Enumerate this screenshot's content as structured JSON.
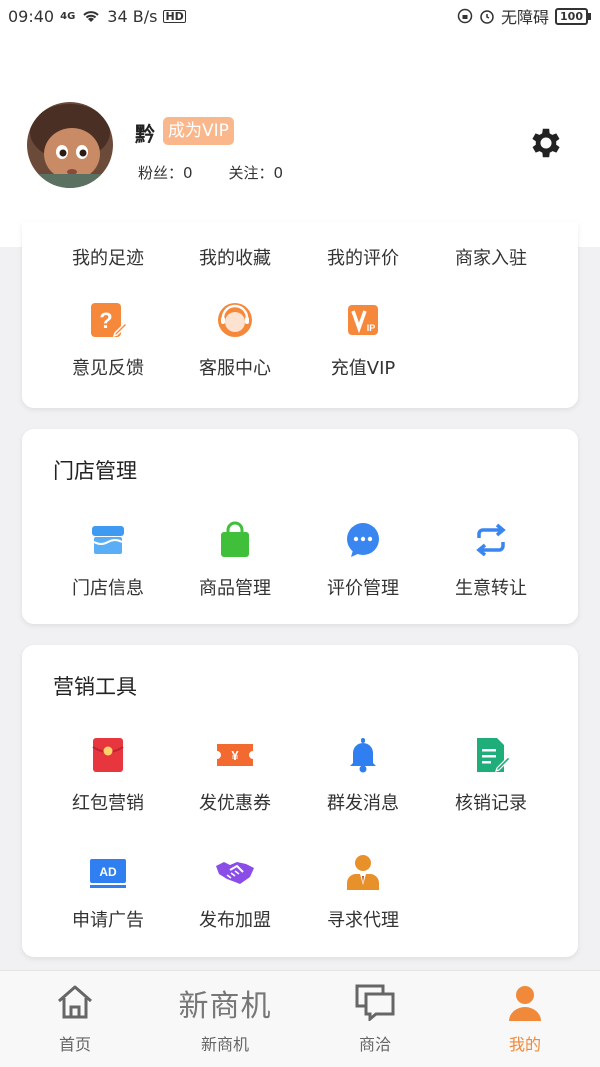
{
  "status_bar": {
    "time": "09:40",
    "network": "4G",
    "speed": "34 B/s",
    "hd": "HD",
    "accessibility": "无障碍",
    "battery": "100"
  },
  "profile": {
    "name": "黔",
    "vip_label": "成为VIP",
    "fans": "粉丝：0",
    "follow": "关注：0",
    "settings_icon": "gear-icon"
  },
  "card1": {
    "row1": [
      {
        "label": "我的足迹"
      },
      {
        "label": "我的收藏"
      },
      {
        "label": "我的评价"
      },
      {
        "label": "商家入驻"
      }
    ],
    "row2": [
      {
        "label": "意见反馈",
        "icon": "feedback-icon",
        "color": "#f5883a"
      },
      {
        "label": "客服中心",
        "icon": "customer-service-icon",
        "color": "#f5883a"
      },
      {
        "label": "充值VIP",
        "icon": "vip-icon",
        "color": "#f5883a"
      }
    ]
  },
  "store": {
    "title": "门店管理",
    "items": [
      {
        "label": "门店信息",
        "icon": "store-icon",
        "color": "#3f9af1"
      },
      {
        "label": "商品管理",
        "icon": "shopping-bag-icon",
        "color": "#3fbf3a"
      },
      {
        "label": "评价管理",
        "icon": "chat-icon",
        "color": "#3a86f0"
      },
      {
        "label": "生意转让",
        "icon": "transfer-icon",
        "color": "#3a86f0"
      }
    ]
  },
  "marketing": {
    "title": "营销工具",
    "items": [
      {
        "label": "红包营销",
        "icon": "red-packet-icon",
        "color": "#e8363f"
      },
      {
        "label": "发优惠券",
        "icon": "coupon-icon",
        "color": "#f26a2f"
      },
      {
        "label": "群发消息",
        "icon": "bell-icon",
        "color": "#2f7ff0"
      },
      {
        "label": "核销记录",
        "icon": "record-icon",
        "color": "#1fae7a"
      },
      {
        "label": "申请广告",
        "icon": "ad-icon",
        "color": "#2f7ff0"
      },
      {
        "label": "发布加盟",
        "icon": "handshake-icon",
        "color": "#8a4de8"
      },
      {
        "label": "寻求代理",
        "icon": "agent-icon",
        "color": "#e8902a"
      }
    ],
    "ad_text": "AD",
    "coupon_text": "¥"
  },
  "tabbar": {
    "tabs": [
      {
        "label": "首页",
        "icon": "home-icon"
      },
      {
        "label": "新商机",
        "icon": "new-opportunity-icon",
        "big": "新商机"
      },
      {
        "label": "商洽",
        "icon": "message-icon"
      },
      {
        "label": "我的",
        "icon": "user-icon"
      }
    ],
    "active_color": "#f08a3a"
  }
}
